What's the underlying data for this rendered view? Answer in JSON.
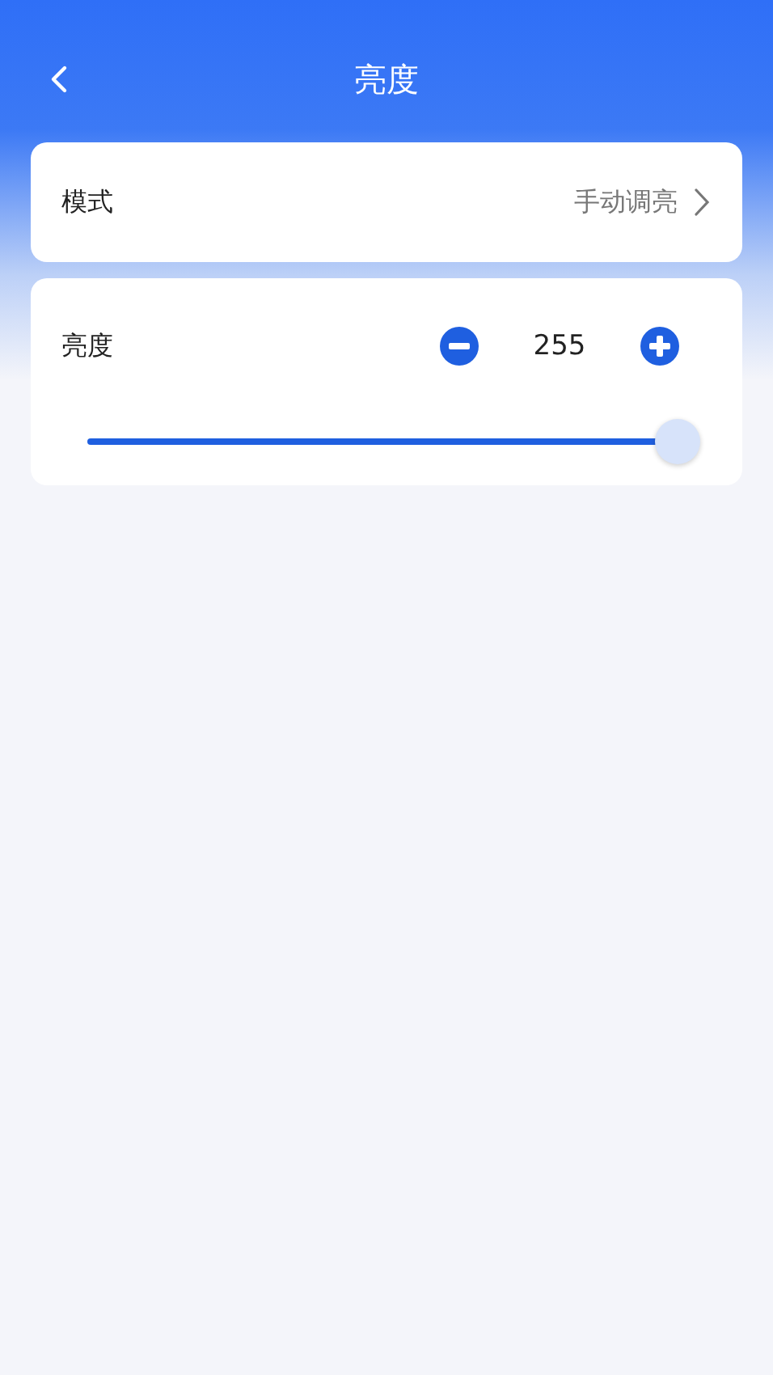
{
  "header": {
    "title": "亮度"
  },
  "mode": {
    "label": "模式",
    "value": "手动调亮"
  },
  "brightness": {
    "label": "亮度",
    "value": "255",
    "level": 1
  }
}
